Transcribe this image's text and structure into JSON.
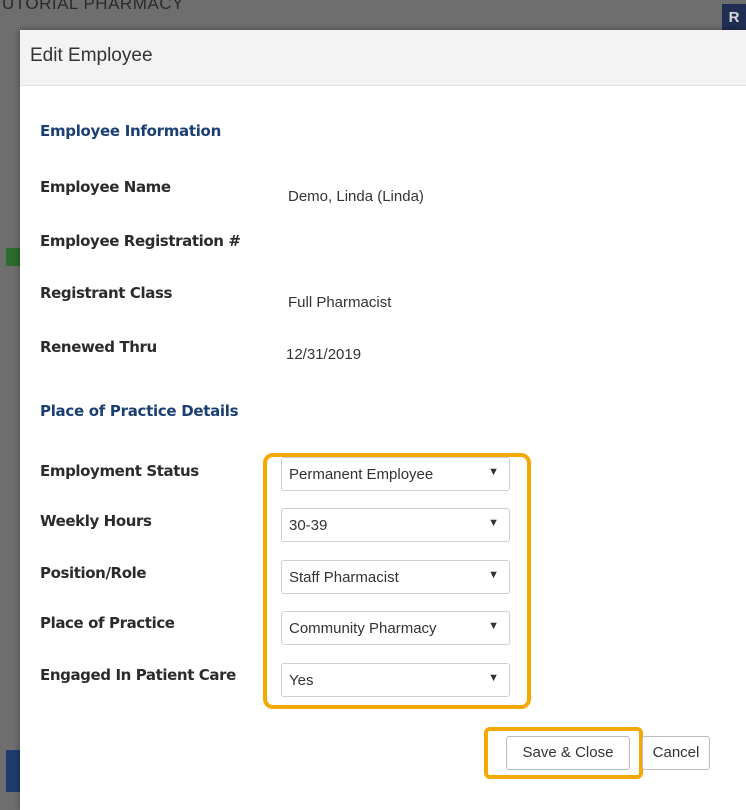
{
  "background": {
    "app_title": "UTORIAL PHARMACY",
    "badge": "R"
  },
  "modal": {
    "title": "Edit Employee",
    "employee_info": {
      "heading": "Employee Information",
      "name_label": "Employee Name",
      "name_value": "Demo, Linda (Linda)",
      "registration_label": "Employee Registration #",
      "registration_value": "",
      "class_label": "Registrant Class",
      "class_value": "Full Pharmacist",
      "renewed_label": "Renewed Thru",
      "renewed_value": "12/31/2019"
    },
    "practice": {
      "heading": "Place of Practice Details",
      "employment_status_label": "Employment Status",
      "employment_status_value": "Permanent Employee",
      "weekly_hours_label": "Weekly Hours",
      "weekly_hours_value": "30-39",
      "position_label": "Position/Role",
      "position_value": "Staff Pharmacist",
      "place_label": "Place of Practice",
      "place_value": "Community Pharmacy",
      "patient_care_label": "Engaged In Patient Care",
      "patient_care_value": "Yes"
    },
    "buttons": {
      "save": "Save & Close",
      "cancel": "Cancel"
    },
    "dropdown_caret": "▼"
  },
  "colors": {
    "highlight": "#f5a800",
    "section_heading": "#1b3f73"
  }
}
